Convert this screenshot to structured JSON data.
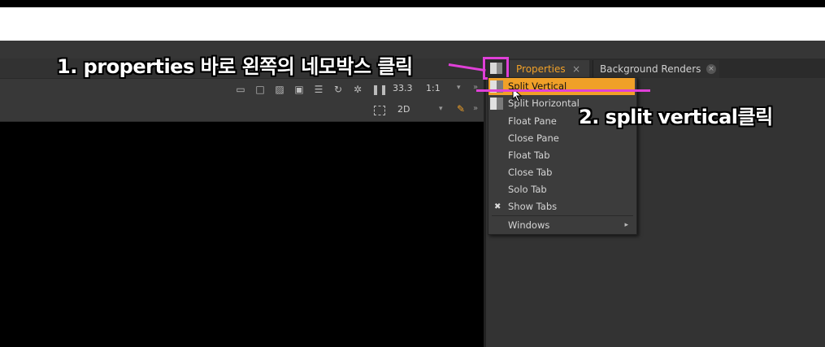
{
  "tabs": [
    {
      "label": "Properties",
      "active": true
    },
    {
      "label": "Background Renders",
      "active": false
    }
  ],
  "tab_close_glyph": "×",
  "viewer_toolbar": {
    "icons": [
      "frame-icon",
      "rect-icon",
      "stripes-icon",
      "overlay-icon",
      "lines-icon",
      "refresh-icon",
      "gear-icon",
      "pause-icon"
    ],
    "zoom": "33.3",
    "ratio": "1:1",
    "mode": "2D"
  },
  "context_menu": {
    "items": [
      {
        "label": "Split Vertical",
        "highlighted": true,
        "icon": "split-vertical-icon"
      },
      {
        "label": "Split Horizontal",
        "icon": "split-horizontal-icon"
      },
      {
        "label": "Float Pane"
      },
      {
        "label": "Close Pane"
      },
      {
        "label": "Float Tab"
      },
      {
        "label": "Close Tab"
      },
      {
        "label": "Solo Tab"
      },
      {
        "label": "Show Tabs",
        "checked": true
      },
      {
        "label": "Windows",
        "submenu": true
      }
    ]
  },
  "annotations": {
    "step1": "1. properties 바로 왼쪽의 네모박스 클릭",
    "step2": "2. split vertical클릭",
    "color": "#e040d8"
  },
  "colors": {
    "accent": "#f0a028",
    "panel": "#323232",
    "viewer": "#000000"
  }
}
